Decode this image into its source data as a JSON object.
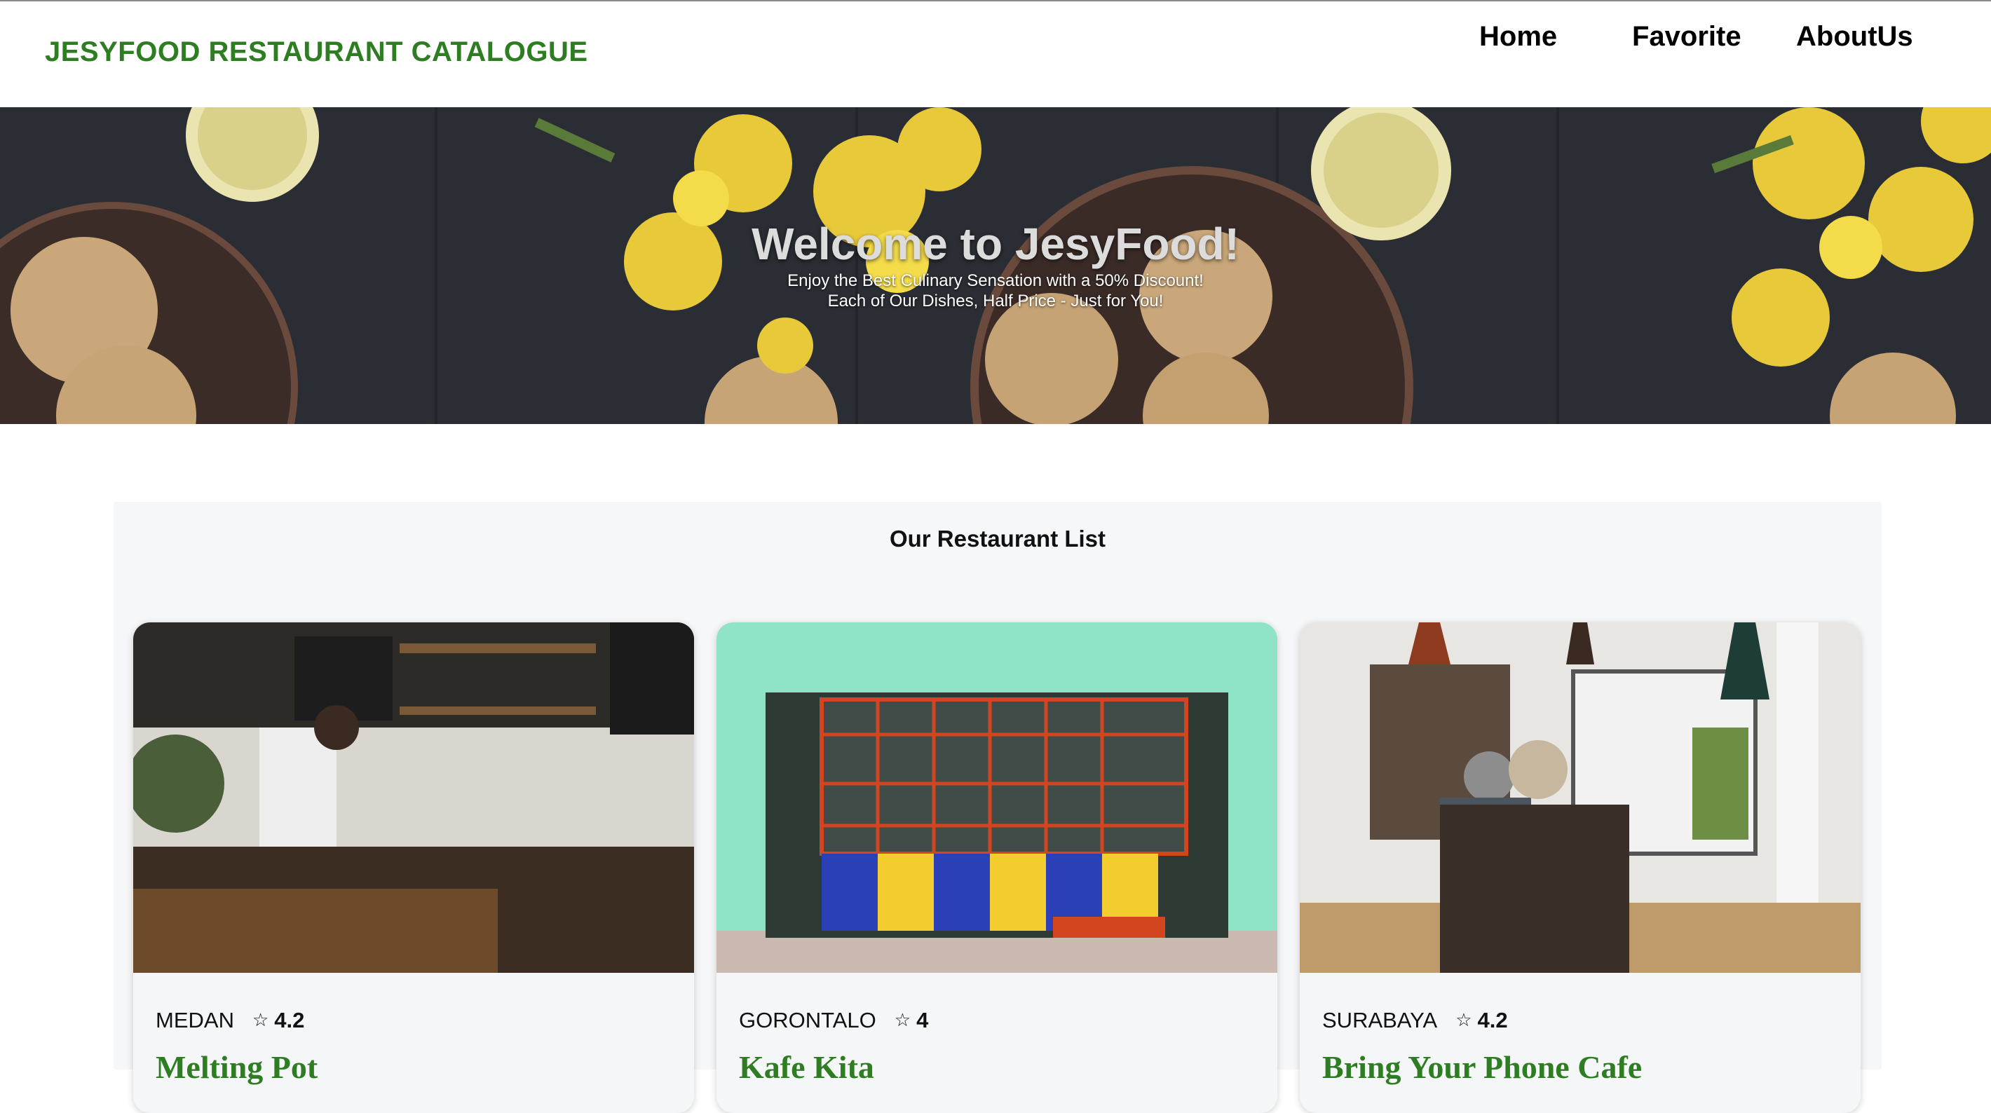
{
  "header": {
    "brand": "JESYFOOD RESTAURANT CATALOGUE",
    "nav": [
      {
        "label": "Home"
      },
      {
        "label": "Favorite"
      },
      {
        "label": "AboutUs"
      }
    ]
  },
  "hero": {
    "title": "Welcome to JesyFood!",
    "subtitle_line1": "Enjoy the Best Culinary Sensation with a 50% Discount!",
    "subtitle_line2": "Each of Our Dishes, Half Price - Just for You!"
  },
  "restaurants": {
    "title": "Our Restaurant List",
    "items": [
      {
        "city": "MEDAN",
        "rating": "4.2",
        "name": "Melting Pot",
        "star_icon": "star-outline-icon"
      },
      {
        "city": "GORONTALO",
        "rating": "4",
        "name": "Kafe Kita",
        "star_icon": "star-outline-icon"
      },
      {
        "city": "SURABAYA",
        "rating": "4.2",
        "name": "Bring Your Phone Cafe",
        "star_icon": "star-outline-icon"
      }
    ]
  },
  "colors": {
    "brand_green": "#2e7d22",
    "hero_bg": "#2a2d33",
    "section_bg": "#f6f7f8"
  }
}
